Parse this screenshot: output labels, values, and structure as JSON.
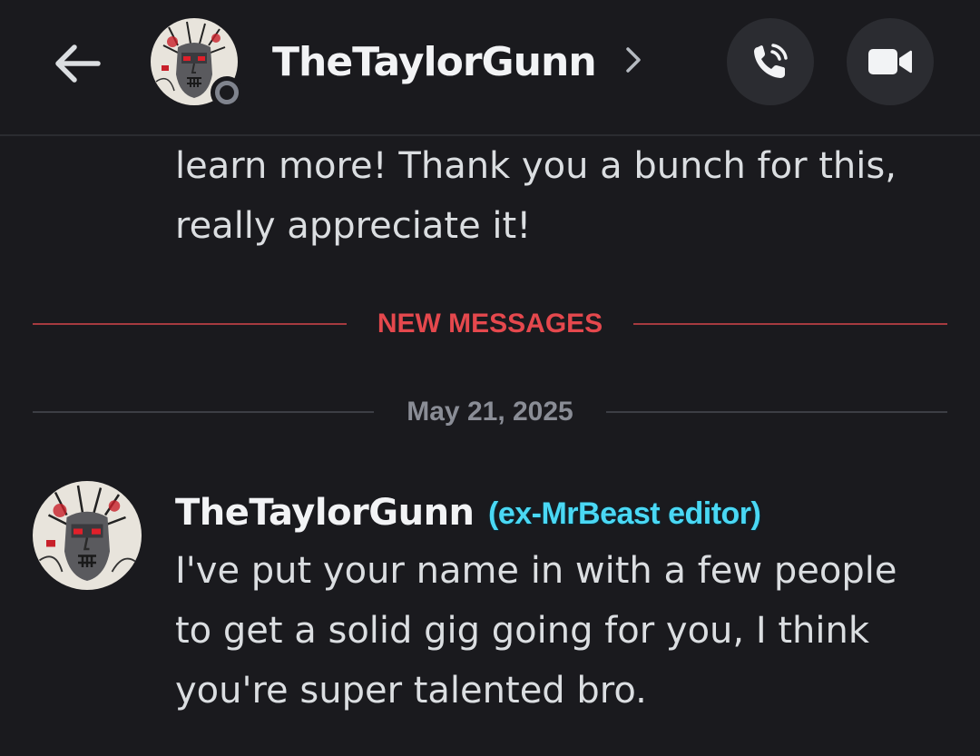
{
  "header": {
    "contact_name": "TheTaylorGunn",
    "status": "offline",
    "icons": {
      "back": "arrow-left-icon",
      "chevron": "chevron-right-icon",
      "call": "phone-call-icon",
      "video": "video-camera-icon"
    }
  },
  "previous_message": {
    "lines": [
      "learn more! Thank you a bunch for this,",
      "really appreciate it!"
    ]
  },
  "new_messages_divider": {
    "label": "NEW MESSAGES",
    "color": "#e5484d"
  },
  "date_divider": {
    "label": "May 21, 2025"
  },
  "message": {
    "author": "TheTaylorGunn",
    "author_tag": "(ex-MrBeast editor)",
    "tag_color": "#4ad8f4",
    "lines": [
      "I've put your name in with a few people",
      "to get a solid gig going for you, I think",
      "you're super talented bro."
    ]
  },
  "colors": {
    "background": "#1a1a1e",
    "button_bg": "#2b2c31",
    "text": "#dbdee1"
  }
}
